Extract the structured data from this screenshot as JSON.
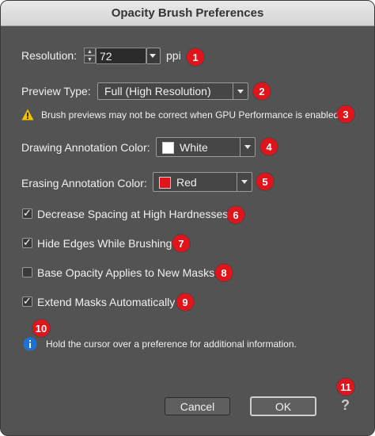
{
  "window": {
    "title": "Opacity Brush Preferences"
  },
  "resolution": {
    "label": "Resolution:",
    "value": "72",
    "unit": "ppi",
    "badge": "1"
  },
  "preview_type": {
    "label": "Preview Type:",
    "value": "Full (High Resolution)",
    "badge": "2"
  },
  "gpu_warning": {
    "text": "Brush previews may not be correct when GPU Performance is enabled",
    "badge": "3",
    "icon": "warning-icon"
  },
  "drawing_color": {
    "label": "Drawing Annotation Color:",
    "value": "White",
    "swatch": "#ffffff",
    "badge": "4"
  },
  "erasing_color": {
    "label": "Erasing Annotation Color:",
    "value": "Red",
    "swatch": "#e0141b",
    "badge": "5"
  },
  "options": [
    {
      "label": "Decrease Spacing at High Hardnesses",
      "checked": true,
      "badge": "6"
    },
    {
      "label": "Hide Edges While Brushing",
      "checked": true,
      "badge": "7"
    },
    {
      "label": "Base Opacity Applies to New Masks",
      "checked": false,
      "badge": "8"
    },
    {
      "label": "Extend Masks Automatically",
      "checked": true,
      "badge": "9"
    }
  ],
  "info": {
    "text": "Hold the cursor over a preference for additional information.",
    "badge": "10",
    "icon": "info-icon"
  },
  "footer": {
    "cancel_label": "Cancel",
    "ok_label": "OK",
    "help_label": "?",
    "badge": "11"
  },
  "colors": {
    "badge": "#e0141b",
    "panel": "#535353",
    "info_icon": "#1d72d6",
    "warning_icon": "#f2c100"
  },
  "check_glyph": "✓"
}
